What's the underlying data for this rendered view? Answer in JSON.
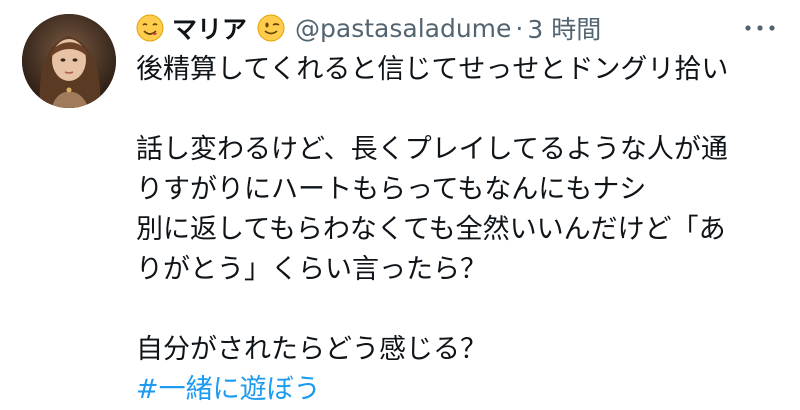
{
  "tweet": {
    "author": {
      "display_name": "マリア",
      "handle": "@pastasaladume",
      "leading_emoji_icon": "savoring-face-emoji",
      "trailing_emoji_icon": "winking-face-emoji"
    },
    "separator": "·",
    "timestamp": "3 時間",
    "more_icon": "ellipsis-icon",
    "body_lines": {
      "l1": "後精算してくれると信じてせっせとドングリ拾い",
      "l2": "話し変わるけど、長くプレイしてるような人が通",
      "l3": "りすがりにハートもらってもなんにもナシ",
      "l4": "別に返してもらわなくても全然いいんだけど「あ",
      "l5": "りがとう」くらい言ったら？",
      "l6": "自分がされたらどう感じる？"
    },
    "hashtag": "#一緒に遊ぼう"
  },
  "colors": {
    "text": "#0f1419",
    "secondary": "#536471",
    "link": "#1d9bf0"
  }
}
